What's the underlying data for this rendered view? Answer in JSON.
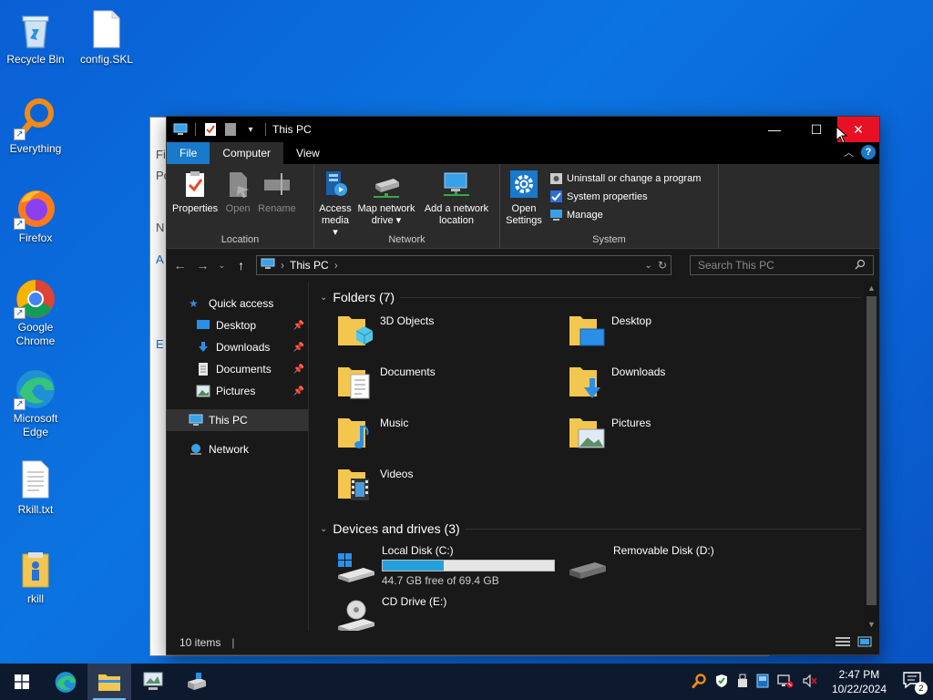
{
  "desktop": {
    "icons": [
      {
        "label": "Recycle Bin"
      },
      {
        "label": "config.SKL"
      },
      {
        "label": "Everything"
      },
      {
        "label": "Firefox"
      },
      {
        "label": "Google Chrome"
      },
      {
        "label": "Microsoft Edge"
      },
      {
        "label": "Rkill.txt"
      },
      {
        "label": "rkill"
      }
    ]
  },
  "background_window": {
    "fragments": [
      "Fi",
      "Pc",
      "N",
      "A",
      "E"
    ]
  },
  "explorer": {
    "title": "This PC",
    "controls": {
      "minimize": "—",
      "maximize": "☐",
      "close": "✕"
    },
    "tabs": [
      {
        "label": "File"
      },
      {
        "label": "Computer"
      },
      {
        "label": "View"
      }
    ],
    "help": "?",
    "ribbon": {
      "location": {
        "label": "Location",
        "buttons": [
          {
            "label": "Properties"
          },
          {
            "label": "Open"
          },
          {
            "label": "Rename"
          }
        ]
      },
      "network": {
        "label": "Network",
        "buttons": [
          {
            "label": "Access media ▾"
          },
          {
            "label": "Map network drive ▾"
          },
          {
            "label": "Add a network location"
          }
        ]
      },
      "system": {
        "label": "System",
        "open_settings": "Open Settings",
        "items": [
          {
            "label": "Uninstall or change a program"
          },
          {
            "label": "System properties"
          },
          {
            "label": "Manage"
          }
        ]
      }
    },
    "address": {
      "path": "This PC",
      "search_placeholder": "Search This PC"
    },
    "navigation": {
      "quick_access": "Quick access",
      "pinned": [
        {
          "label": "Desktop"
        },
        {
          "label": "Downloads"
        },
        {
          "label": "Documents"
        },
        {
          "label": "Pictures"
        }
      ],
      "this_pc": "This PC",
      "network": "Network"
    },
    "folders_header": "Folders (7)",
    "folders": [
      {
        "name": "3D Objects"
      },
      {
        "name": "Desktop"
      },
      {
        "name": "Documents"
      },
      {
        "name": "Downloads"
      },
      {
        "name": "Music"
      },
      {
        "name": "Pictures"
      },
      {
        "name": "Videos"
      }
    ],
    "drives_header": "Devices and drives (3)",
    "drives": [
      {
        "name": "Local Disk (C:)",
        "free_text": "44.7 GB free of 69.4 GB",
        "used_fraction": 0.356
      },
      {
        "name": "Removable Disk (D:)"
      },
      {
        "name": "CD Drive (E:)"
      }
    ],
    "status": "10 items"
  },
  "taskbar": {
    "time": "2:47 PM",
    "date": "10/22/2024",
    "notification_count": "2"
  },
  "colors": {
    "accent": "#1979ca",
    "close_red": "#e81123",
    "folder_yellow": "#f3c74f",
    "drive_fill": "#26a0da"
  }
}
